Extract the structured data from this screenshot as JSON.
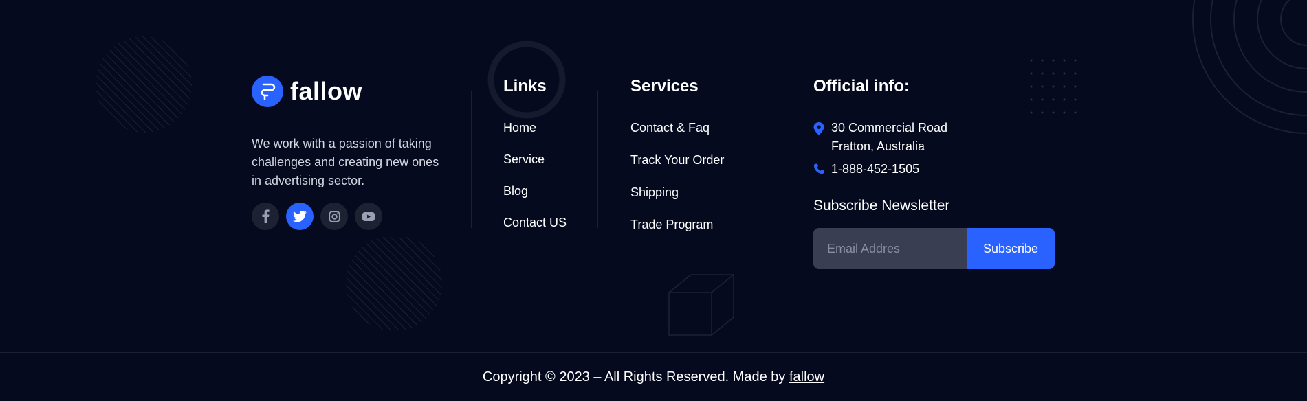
{
  "brand": {
    "name": "fallow",
    "accent_color": "#2962ff",
    "background_color": "#050a1f"
  },
  "about": {
    "text": "We work with a passion of taking challenges and creating new ones in advertising sector."
  },
  "socials": [
    {
      "icon": "facebook-icon"
    },
    {
      "icon": "twitter-icon",
      "active": true
    },
    {
      "icon": "instagram-icon"
    },
    {
      "icon": "youtube-icon"
    }
  ],
  "links": {
    "title": "Links",
    "items": [
      "Home",
      "Service",
      "Blog",
      "Contact US"
    ]
  },
  "services": {
    "title": "Services",
    "items": [
      "Contact & Faq",
      "Track Your Order",
      "Shipping",
      "Trade Program"
    ]
  },
  "official_info": {
    "title": "Official info:",
    "address_line1": "30 Commercial Road",
    "address_line2": "Fratton, Australia",
    "phone": "1-888-452-1505",
    "address_icon": "location-pin-icon",
    "phone_icon": "phone-icon"
  },
  "newsletter": {
    "title": "Subscribe Newsletter",
    "placeholder": "Email Addres",
    "button_label": "Subscribe"
  },
  "footer": {
    "copyright_prefix": "Copyright © 2023 – All Rights Reserved. Made by",
    "brand_link": "fallow"
  }
}
